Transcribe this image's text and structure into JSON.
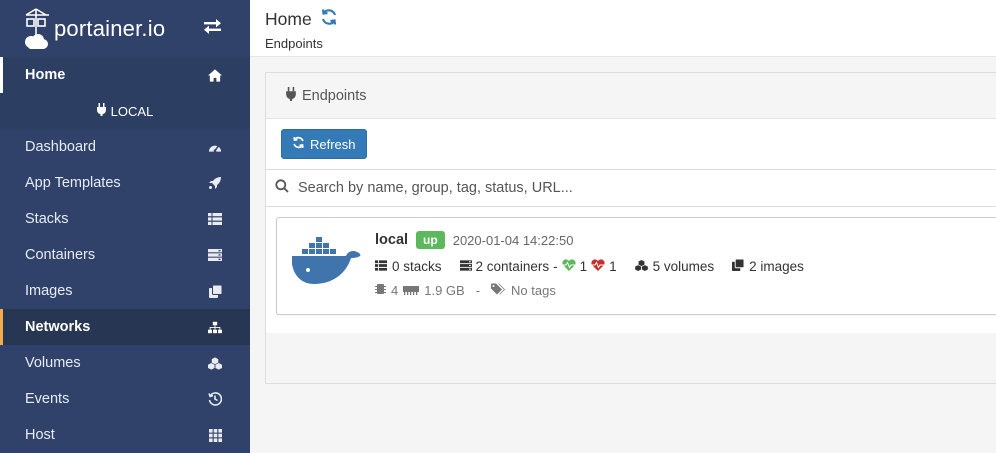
{
  "brand": {
    "name": "portainer.io"
  },
  "sidebar": {
    "home_label": "Home",
    "endpoint_title": "LOCAL",
    "items": [
      {
        "label": "Dashboard",
        "icon": "tachometer-icon"
      },
      {
        "label": "App Templates",
        "icon": "rocket-icon"
      },
      {
        "label": "Stacks",
        "icon": "th-list-icon"
      },
      {
        "label": "Containers",
        "icon": "server-icon"
      },
      {
        "label": "Images",
        "icon": "clone-icon"
      },
      {
        "label": "Networks",
        "icon": "sitemap-icon"
      },
      {
        "label": "Volumes",
        "icon": "cubes-icon"
      },
      {
        "label": "Events",
        "icon": "history-icon"
      },
      {
        "label": "Host",
        "icon": "th-icon"
      }
    ],
    "active_item": "Networks"
  },
  "header": {
    "title": "Home",
    "breadcrumb": "Endpoints"
  },
  "widget": {
    "title": "Endpoints",
    "refresh_label": "Refresh",
    "search_placeholder": "Search by name, group, tag, status, URL..."
  },
  "endpoint": {
    "name": "local",
    "status": "up",
    "timestamp": "2020-01-04 14:22:50",
    "stacks": "0 stacks",
    "containers": "2 containers",
    "separator": "-",
    "healthy": "1",
    "unhealthy": "1",
    "volumes": "5 volumes",
    "images": "2 images",
    "cpu": "4",
    "memory": "1.9 GB",
    "tags_separator": "-",
    "tags": "No tags"
  },
  "colors": {
    "sidebar_bg": "#30426a",
    "accent": "#f0ad4e",
    "button": "#337ab7",
    "badge_up": "#5cb85c",
    "docker_blue": "#3f74ad"
  }
}
